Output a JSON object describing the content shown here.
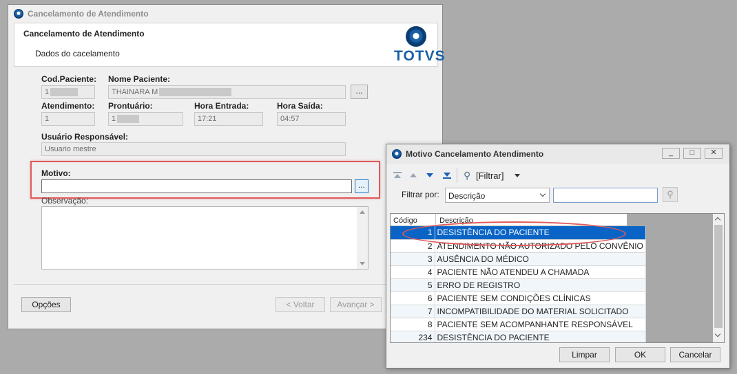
{
  "main_window": {
    "title": "Cancelamento de Atendimento",
    "header_title": "Cancelamento de Atendimento",
    "header_subtitle": "Dados do cacelamento",
    "brand": "TOTVS",
    "labels": {
      "cod_paciente": "Cod.Paciente:",
      "nome_paciente": "Nome Paciente:",
      "atendimento": "Atendimento:",
      "prontuario": "Prontuário:",
      "hora_entrada": "Hora Entrada:",
      "hora_saida": "Hora Saída:",
      "usuario": "Usuário Responsável:",
      "motivo": "Motivo:",
      "observacao": "Observação:"
    },
    "values": {
      "cod_paciente": "1",
      "nome_paciente": "THAINARA M",
      "atendimento": "1",
      "prontuario": "1",
      "hora_entrada": "17:21",
      "hora_saida": "04:57",
      "usuario": "Usuario mestre",
      "motivo": "",
      "observacao": ""
    },
    "lookup_button": "...",
    "buttons": {
      "opcoes": "Opções",
      "voltar": "< Voltar",
      "avancar": "Avançar >"
    }
  },
  "dialog": {
    "title": "Motivo Cancelamento Atendimento",
    "window_controls": {
      "minimize": "_",
      "maximize": "□",
      "close": "✕"
    },
    "toolbar": {
      "filtrar": "[Filtrar]"
    },
    "filter_label": "Filtrar por:",
    "filter_option": "Descrição",
    "filter_value": "",
    "columns": {
      "codigo": "Código",
      "descricao": "Descrição"
    },
    "rows": [
      {
        "codigo": "1",
        "descricao": "DESISTÊNCIA DO PACIENTE"
      },
      {
        "codigo": "2",
        "descricao": "ATENDIMENTO NÃO AUTORIZADO PELO CONVÊNIO"
      },
      {
        "codigo": "3",
        "descricao": "AUSÊNCIA DO MÉDICO"
      },
      {
        "codigo": "4",
        "descricao": "PACIENTE NÃO ATENDEU A CHAMADA"
      },
      {
        "codigo": "5",
        "descricao": "ERRO DE REGISTRO"
      },
      {
        "codigo": "6",
        "descricao": "PACIENTE SEM CONDIÇÕES CLÍNICAS"
      },
      {
        "codigo": "7",
        "descricao": "INCOMPATIBILIDADE DO MATERIAL SOLICITADO"
      },
      {
        "codigo": "8",
        "descricao": "PACIENTE SEM ACOMPANHANTE RESPONSÁVEL"
      },
      {
        "codigo": "234",
        "descricao": "DESISTÊNCIA DO PACIENTE"
      }
    ],
    "buttons": {
      "limpar": "Limpar",
      "ok": "OK",
      "cancelar": "Cancelar"
    }
  },
  "colors": {
    "annotation": "#e05a5a",
    "selection": "#0a64c6",
    "brand": "#1b5fa5"
  }
}
